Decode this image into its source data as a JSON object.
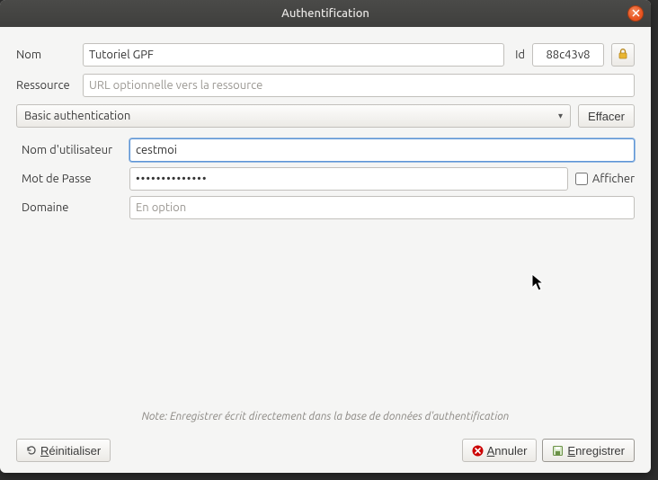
{
  "window": {
    "title": "Authentification"
  },
  "labels": {
    "name": "Nom",
    "id": "Id",
    "resource": "Ressource",
    "username": "Nom d'utilisateur",
    "password": "Mot de Passe",
    "domain": "Domaine",
    "show": "Afficher"
  },
  "fields": {
    "name_value": "Tutoriel GPF",
    "id_value": "88c43v8",
    "resource_placeholder": "URL optionnelle vers la ressource",
    "resource_value": "",
    "auth_type": "Basic authentication",
    "username_value": "cestmoi",
    "password_value": "••••••••••••••",
    "domain_placeholder": "En option",
    "domain_value": ""
  },
  "buttons": {
    "clear": "Effacer",
    "reset": "Réinitialiser",
    "cancel": "Annuler",
    "save": "Enregistrer"
  },
  "note": "Note: Enregistrer écrit directement dans la base de données d'authentification"
}
